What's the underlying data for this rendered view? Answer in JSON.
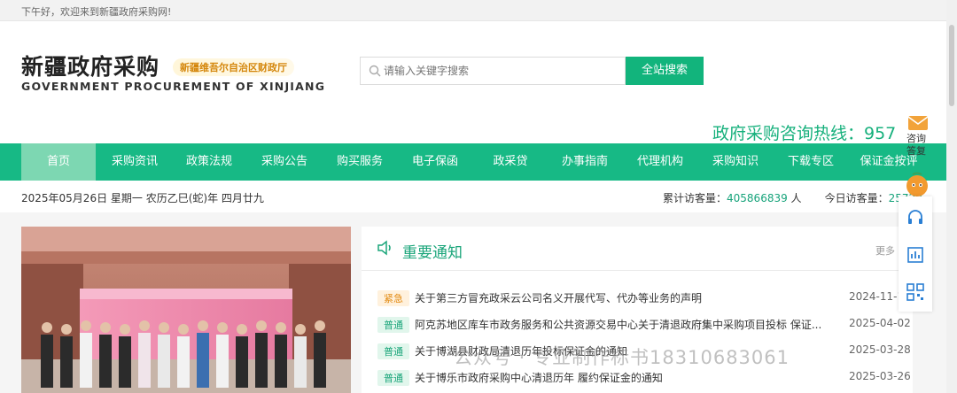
{
  "topbar": {
    "greeting": "下午好，欢迎来到新疆政府采购网!"
  },
  "header": {
    "logo_cn": "新疆政府采购",
    "logo_en": "GOVERNMENT PROCUREMENT OF XINJIANG",
    "logo_tag": "新疆维吾尔自治区财政厅",
    "search_placeholder": "请输入关键字搜索",
    "search_button": "全站搜索",
    "hotline": "政府采购咨询热线：957"
  },
  "nav": {
    "items": [
      {
        "label": "首页",
        "active": true
      },
      {
        "label": "采购资讯"
      },
      {
        "label": "政策法规"
      },
      {
        "label": "采购公告"
      },
      {
        "label": "购买服务"
      },
      {
        "label": "电子保函"
      },
      {
        "label": "政采贷"
      },
      {
        "label": "办事指南"
      },
      {
        "label": "代理机构"
      },
      {
        "label": "采购知识"
      },
      {
        "label": "下载专区"
      },
      {
        "label": "保证金按评"
      }
    ]
  },
  "datebar": {
    "date": "2025年05月26日 星期一 农历乙巳(蛇)年 四月廿九",
    "total_label": "累计访客量：",
    "total_value": "405866839",
    "total_unit": " 人",
    "today_label": "今日访客量：",
    "today_value": "25720"
  },
  "notice": {
    "title": "重要通知",
    "more": "更多",
    "rows": [
      {
        "badge": "紧急",
        "type": "urgent",
        "title": "关于第三方冒充政采云公司名义开展代写、代办等业务的声明",
        "date": "2024-11-15"
      },
      {
        "badge": "普通",
        "type": "normal",
        "title": "阿克苏地区库车市政务服务和公共资源交易中心关于清退政府集中采购项目投标 保证...",
        "date": "2025-04-02"
      },
      {
        "badge": "普通",
        "type": "normal",
        "title": "关于博湖县财政局清退历年投标保证金的通知",
        "date": "2025-03-28"
      },
      {
        "badge": "普通",
        "type": "normal",
        "title": "关于博乐市政府采购中心清退历年 履约保证金的通知",
        "date": "2025-03-26"
      }
    ]
  },
  "side": {
    "consult_line1": "咨询",
    "consult_line2": "答复"
  },
  "watermark": "公众号 · 专业制作标书18310683061"
}
